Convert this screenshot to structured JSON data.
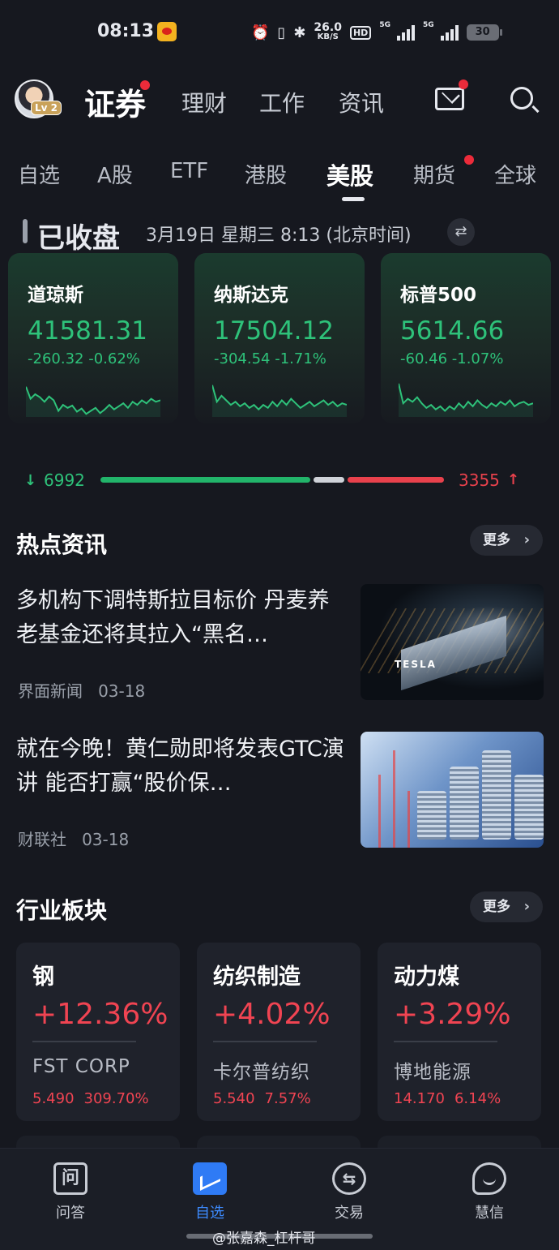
{
  "status_bar": {
    "time": "08:13",
    "net_speed": "26.0",
    "net_unit": "KB/S",
    "hd_label": "HD",
    "signal_labels": [
      "5G",
      "5G"
    ],
    "battery": "30",
    "icons": [
      "weibo-icon",
      "alarm-icon",
      "vibrate-icon",
      "bluetooth-icon",
      "signal-icon",
      "battery-icon"
    ]
  },
  "header": {
    "avatar_level": "Lv 2",
    "nav": [
      "证券",
      "理财",
      "工作",
      "资讯"
    ],
    "active_nav": "证券",
    "icons": [
      "mail-icon",
      "search-icon"
    ]
  },
  "market_tabs": [
    "自选",
    "A股",
    "ETF",
    "港股",
    "美股",
    "期货",
    "全球"
  ],
  "active_market_tab": "美股",
  "market_status": {
    "title": "已收盘",
    "datetime": "3月19日  星期三  8:13 (北京时间)"
  },
  "indices": [
    {
      "name": "道琼斯",
      "value": "41581.31",
      "change": "-260.32 -0.62%",
      "spark": [
        20,
        36,
        30,
        34,
        40,
        33,
        38,
        52,
        44,
        48,
        45,
        53,
        49,
        56,
        52,
        48,
        55,
        50,
        44,
        50,
        46,
        42,
        48,
        40,
        44,
        38,
        42,
        36,
        40,
        38
      ]
    },
    {
      "name": "纳斯达克",
      "value": "17504.12",
      "change": "-304.54 -1.71%",
      "spark": [
        18,
        40,
        32,
        38,
        44,
        40,
        46,
        42,
        48,
        44,
        50,
        44,
        48,
        40,
        46,
        38,
        44,
        36,
        42,
        48,
        44,
        40,
        46,
        42,
        38,
        44,
        40,
        46,
        42,
        44
      ]
    },
    {
      "name": "标普500",
      "value": "5614.66",
      "change": "-60.46 -1.07%",
      "spark": [
        16,
        42,
        36,
        40,
        34,
        42,
        48,
        44,
        50,
        46,
        52,
        46,
        50,
        42,
        48,
        40,
        46,
        38,
        44,
        48,
        42,
        46,
        40,
        44,
        38,
        46,
        42,
        40,
        44,
        42
      ]
    }
  ],
  "breadth": {
    "down": "6992",
    "up": "3355",
    "down_share": 0.62,
    "flat_share": 0.1,
    "up_share": 0.28
  },
  "hot_news": {
    "title": "热点资讯",
    "more": "更多",
    "items": [
      {
        "title": " 多机构下调特斯拉目标价 丹麦养老基金还将其拉入“黑名…",
        "source": "界面新闻",
        "date": "03-18",
        "image": "tesla-factory-night"
      },
      {
        "title": " 就在今晚！黄仁勋即将发表GTC演讲 能否打赢“股价保…",
        "source": "财联社",
        "date": "03-18",
        "image": "coin-stacks"
      }
    ],
    "image_sign": "TESLA"
  },
  "sectors": {
    "title": "行业板块",
    "more": "更多",
    "items": [
      {
        "name": "钢",
        "pct": "+12.36%",
        "stock": "FST  CORP",
        "price": "5.490",
        "stock_pct": "309.70%"
      },
      {
        "name": "纺织制造",
        "pct": "+4.02%",
        "stock": "卡尔普纺织",
        "price": "5.540",
        "stock_pct": "7.57%"
      },
      {
        "name": "动力煤",
        "pct": "+3.29%",
        "stock": "博地能源",
        "price": "14.170",
        "stock_pct": "6.14%"
      }
    ]
  },
  "bottom_nav": [
    {
      "label": "问答",
      "icon": "qa-icon",
      "glyph": "问"
    },
    {
      "label": "自选",
      "icon": "watchlist-icon",
      "glyph": ""
    },
    {
      "label": "交易",
      "icon": "trade-icon",
      "glyph": "⇆"
    },
    {
      "label": "慧信",
      "icon": "chat-icon",
      "glyph": ""
    }
  ],
  "active_bottom": "自选",
  "watermark": "@张嘉森_杠杆哥",
  "colors": {
    "up": "#f04452",
    "down": "#2ec27a",
    "accent": "#2f7bf5",
    "bg": "#16181f"
  }
}
